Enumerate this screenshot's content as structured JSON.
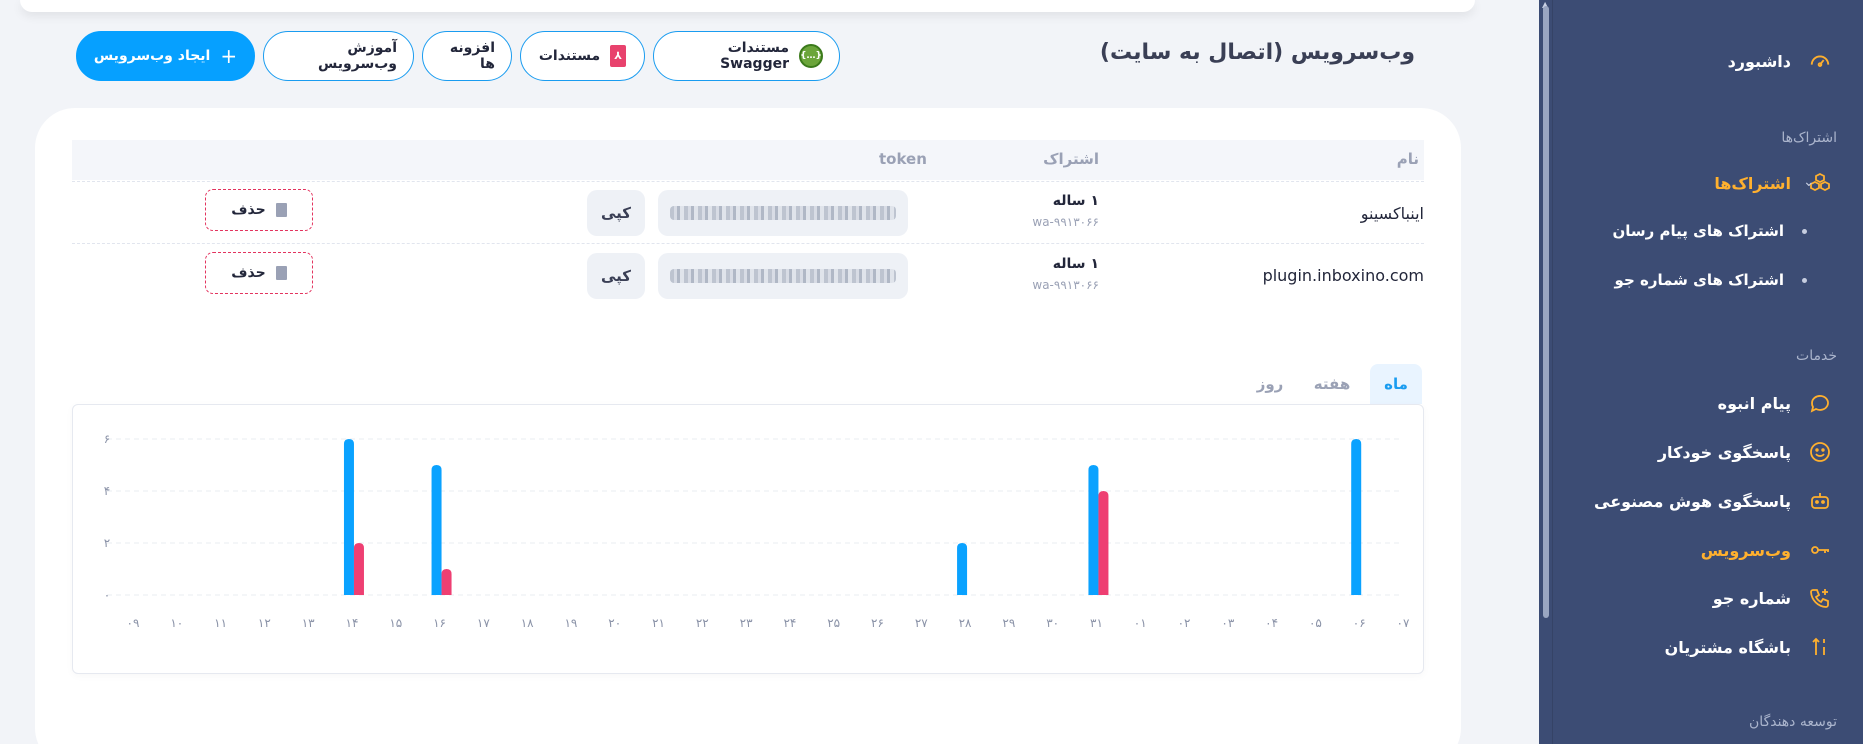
{
  "header": {
    "title": "وب‌سرویس (اتصال به سایت)",
    "buttons": {
      "swagger": "مستندات Swagger",
      "docs": "مستندات",
      "plugins": "افزونه ها",
      "tutorial": "آموزش وب‌سرویس",
      "create": "ایجاد وب‌سرویس"
    }
  },
  "sidebar": {
    "dashboard": "داشبورد",
    "section_subscriptions": "اشتراک‌ها",
    "subscriptions": "اشتراک‌ها",
    "sub_items": [
      "اشتراک های پیام رسان",
      "اشتراک های شماره جو"
    ],
    "section_services": "خدمات",
    "services": [
      "پیام انبوه",
      "پاسخگوی خودکار",
      "پاسخگوی هوش مصنوعی",
      "وب‌سرویس",
      "شماره جو",
      "باشگاه مشتریان"
    ],
    "section_developers": "توسعه دهندگان",
    "active": "وب‌سرویس",
    "colors": {
      "bg": "#3c4c74",
      "active": "#ffb02e"
    }
  },
  "table": {
    "headers": {
      "name": "نام",
      "subscription": "اشتراک",
      "token": "token"
    },
    "rows": [
      {
        "name": "اینباکسینو",
        "plan": "۱ ساله",
        "code": "wa-۹۹۱۳۰۶۶",
        "copy": "کپی",
        "delete": "حذف"
      },
      {
        "name": "plugin.inboxino.com",
        "plan": "۱ ساله",
        "code": "wa-۹۹۱۳۰۶۶",
        "copy": "کپی",
        "delete": "حذف"
      }
    ]
  },
  "tabs": [
    "ماه",
    "هفته",
    "روز"
  ],
  "chart_data": {
    "type": "bar",
    "categories": [
      "۰۹",
      "۱۰",
      "۱۱",
      "۱۲",
      "۱۳",
      "۱۴",
      "۱۵",
      "۱۶",
      "۱۷",
      "۱۸",
      "۱۹",
      "۲۰",
      "۲۱",
      "۲۲",
      "۲۳",
      "۲۴",
      "۲۵",
      "۲۶",
      "۲۷",
      "۲۸",
      "۲۹",
      "۳۰",
      "۳۱",
      "۰۱",
      "۰۲",
      "۰۳",
      "۰۴",
      "۰۵",
      "۰۶",
      "۰۷"
    ],
    "series": [
      {
        "color": "#0aa2ff",
        "values": [
          0,
          0,
          0,
          0,
          0,
          6,
          0,
          5,
          0,
          0,
          0,
          0,
          0,
          0,
          0,
          0,
          0,
          0,
          0,
          2,
          0,
          0,
          5,
          0,
          0,
          0,
          0,
          0,
          6,
          0
        ]
      },
      {
        "color": "#ee3f72",
        "values": [
          0,
          0,
          0,
          0,
          0,
          2,
          0,
          1,
          0,
          0,
          0,
          0,
          0,
          0,
          0,
          0,
          0,
          0,
          0,
          0,
          0,
          0,
          4,
          0,
          0,
          0,
          0,
          0,
          0,
          0
        ]
      }
    ],
    "yticks": [
      "۰",
      "۲",
      "۴",
      "۶"
    ],
    "ylim": [
      0,
      6
    ],
    "grid": true,
    "title": "",
    "xlabel": "",
    "ylabel": ""
  },
  "colors": {
    "primary": "#06a0ff",
    "danger": "#e3335e"
  }
}
